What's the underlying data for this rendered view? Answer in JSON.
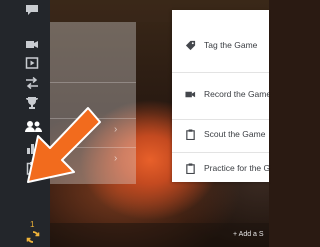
{
  "menu": {
    "items": [
      {
        "label": "Tag the Game",
        "icon": "tag-icon"
      },
      {
        "label": "Record the Game",
        "icon": "video-camera-icon"
      },
      {
        "label": "Scout the Game",
        "icon": "clipboard-icon"
      },
      {
        "label": "Practice for the Gam",
        "icon": "clipboard-icon"
      }
    ]
  },
  "sidebar": {
    "icons": [
      "chat-icon",
      "video-camera-icon",
      "play-square-icon",
      "transfer-arrows-icon",
      "trophy-icon",
      "team-icon",
      "stats-icon",
      "clipboard-icon"
    ],
    "sync_count": "1"
  },
  "bottom_bar": {
    "add_label": "+ Add a S"
  },
  "colors": {
    "rail": "#23262b",
    "accent_arrow": "#f26b1d",
    "sync": "#f0b43a"
  }
}
